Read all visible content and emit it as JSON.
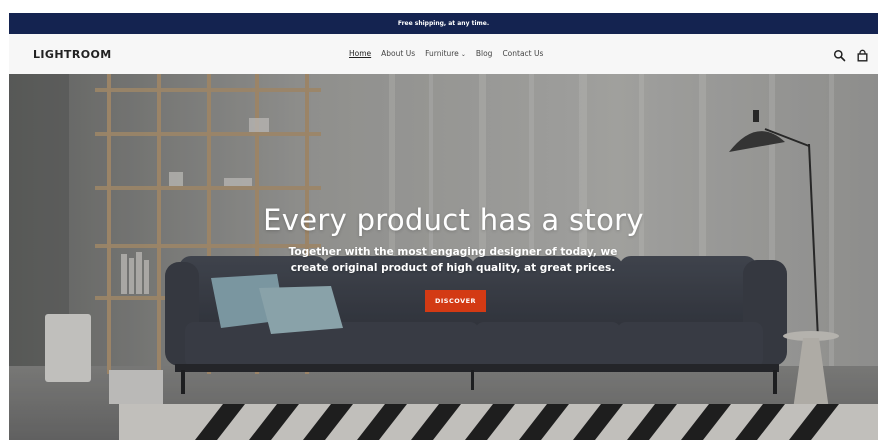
{
  "announcement": "Free shipping, at any time.",
  "header": {
    "logo": "LIGHTROOM",
    "nav": {
      "home": "Home",
      "about": "About Us",
      "furniture": "Furniture",
      "blog": "Blog",
      "contact": "Contact Us"
    },
    "icons": [
      "search-icon",
      "shopping-bag-icon"
    ]
  },
  "hero": {
    "title": "Every product has a story",
    "subtitle": "Together with the most engaging designer of today, we create original product of high quality, at great prices.",
    "cta": "DISCOVER"
  },
  "colors": {
    "announcement_bg": "#142350",
    "header_bg": "#f7f7f7",
    "cta_bg": "#d33a14",
    "text_dark": "#222222"
  }
}
